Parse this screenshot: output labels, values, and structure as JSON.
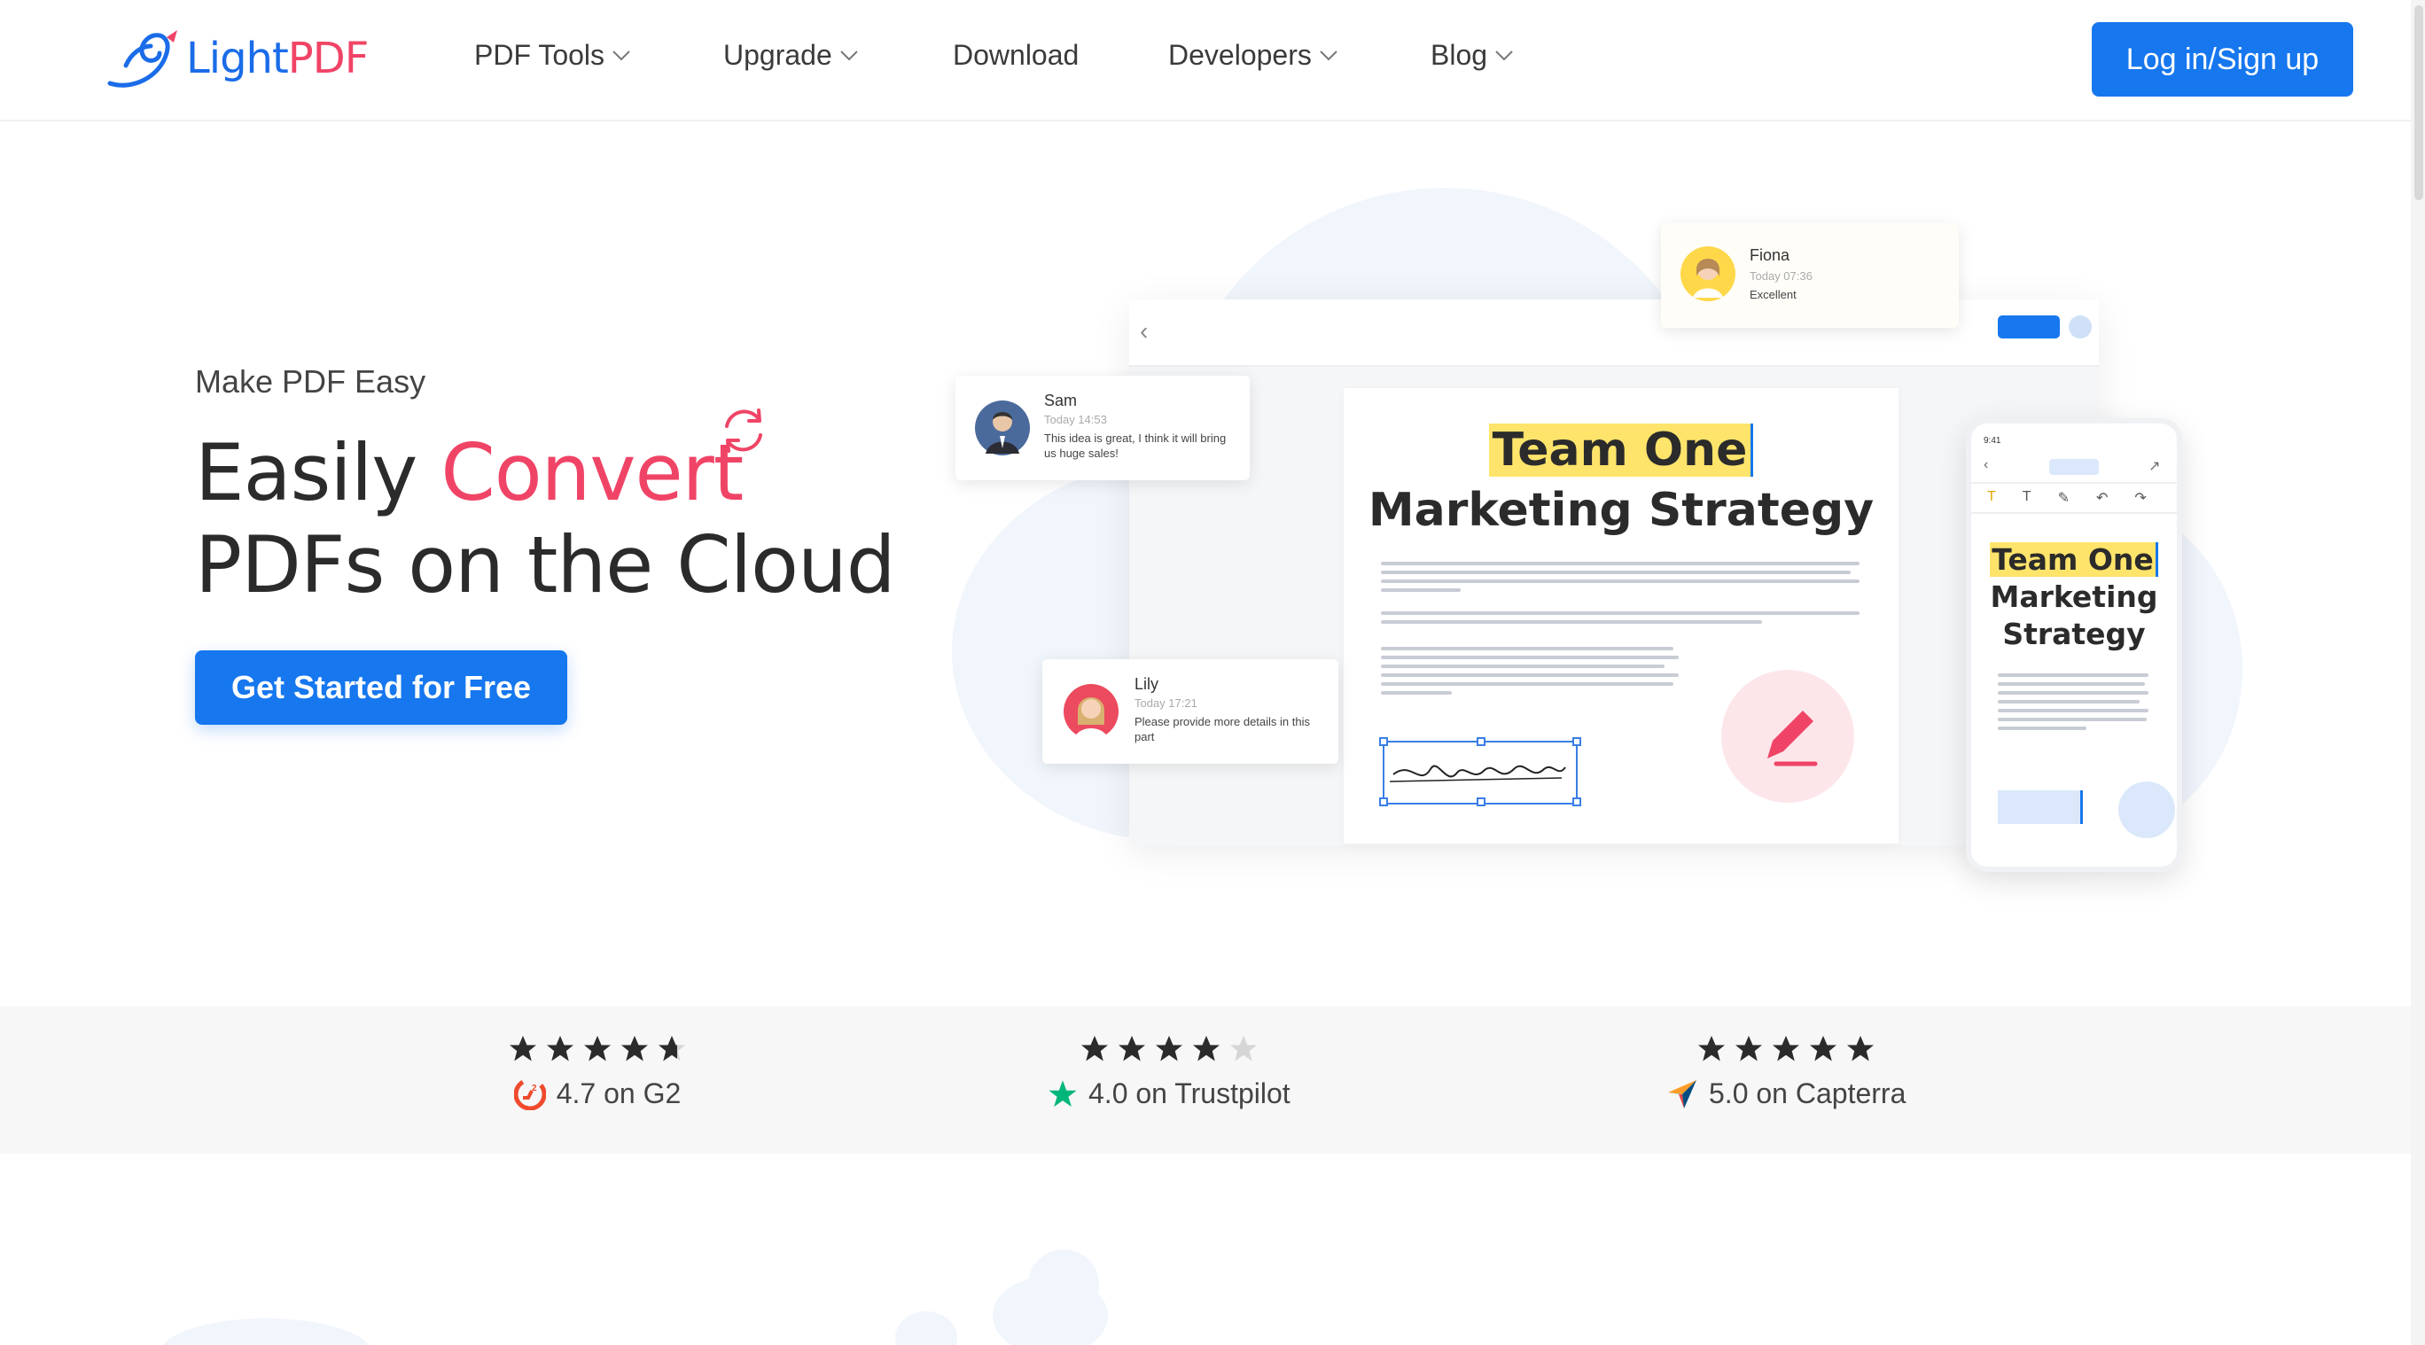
{
  "nav": {
    "logo_text_a": "Light",
    "logo_text_b": "PDF",
    "items": [
      {
        "label": "PDF Tools",
        "has_dropdown": true
      },
      {
        "label": "Upgrade",
        "has_dropdown": true
      },
      {
        "label": "Download",
        "has_dropdown": false
      },
      {
        "label": "Developers",
        "has_dropdown": true
      },
      {
        "label": "Blog",
        "has_dropdown": true
      }
    ],
    "login_label": "Log in/Sign up"
  },
  "hero": {
    "tagline": "Make PDF Easy",
    "title_part1": "Easily ",
    "title_accent": "Convert",
    "title_line2": "PDFs on the Cloud",
    "cta_label": "Get Started for Free"
  },
  "illustration": {
    "comments": [
      {
        "name": "Fiona",
        "time": "Today 07:36",
        "message": "Excellent"
      },
      {
        "name": "Sam",
        "time": "Today 14:53",
        "message": "This idea is great, I think it will bring us huge sales!"
      },
      {
        "name": "Lily",
        "time": "Today 17:21",
        "message": "Please provide more details in this part"
      }
    ],
    "doc_title_line1": "Team One",
    "doc_title_line2": "Marketing Strategy",
    "phone_title_line1": "Team One",
    "phone_title_line2": "Marketing",
    "phone_title_line3": "Strategy",
    "phone_time": "9:41"
  },
  "ratings": [
    {
      "stars": 4.7,
      "label": "4.7 on G2",
      "icon": "g2-icon"
    },
    {
      "stars": 4.0,
      "label": "4.0 on Trustpilot",
      "icon": "trustpilot-star-icon"
    },
    {
      "stars": 5.0,
      "label": "5.0 on Capterra",
      "icon": "capterra-icon"
    }
  ],
  "colors": {
    "primary": "#1677ee",
    "accent": "#f04466",
    "highlight": "#ffe46b",
    "star": "#2b2b2b",
    "trustpilot": "#00b67a"
  }
}
